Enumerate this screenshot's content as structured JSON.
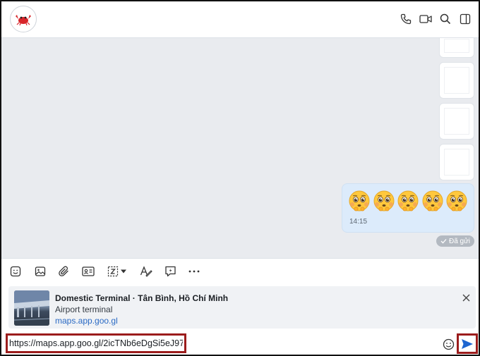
{
  "header": {
    "avatar_icon": "crab-icon",
    "icons": [
      "phone-icon",
      "video-icon",
      "search-icon",
      "sidebar-icon"
    ]
  },
  "messages": {
    "emoji_count": 5,
    "emoji_icon": "pleading-face-emoji",
    "time": "14:15",
    "status": "Đã gửi"
  },
  "toolbar": {
    "icons": [
      "sticker-icon",
      "image-icon",
      "attachment-icon",
      "contact-card-icon",
      "screenshot-icon",
      "dropdown-icon",
      "format-text-icon",
      "quick-message-icon",
      "more-icon"
    ]
  },
  "link_preview": {
    "title": "Domestic Terminal · Tân Bình, Hồ Chí Minh",
    "subtitle": "Airport terminal",
    "link": "maps.app.goo.gl"
  },
  "composer": {
    "value": "https://maps.app.goo.gl/2icTNb6eDgSi5eJ97",
    "highlight_color": "#9b1c1c",
    "send_color": "#1e66d0"
  }
}
